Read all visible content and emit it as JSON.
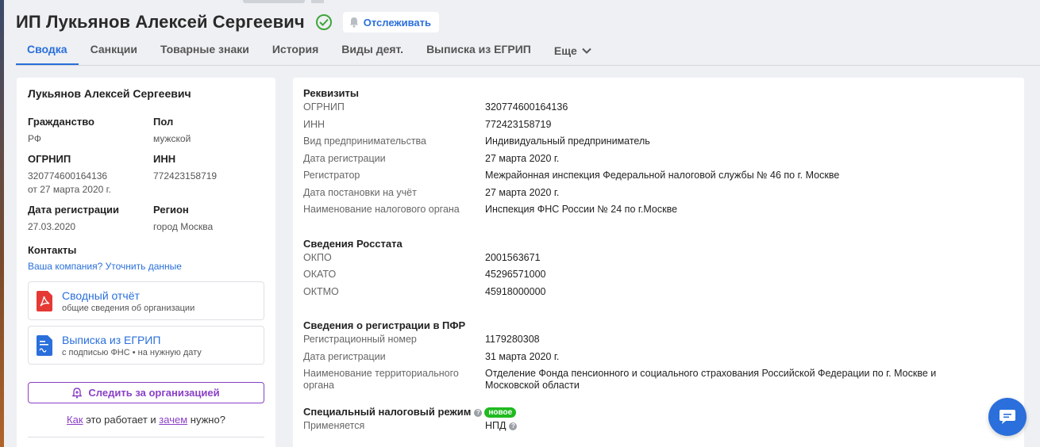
{
  "header": {
    "title": "ИП Лукьянов Алексей Сергеевич",
    "track_label": "Отслеживать"
  },
  "tabs": [
    {
      "label": "Сводка"
    },
    {
      "label": "Санкции"
    },
    {
      "label": "Товарные знаки"
    },
    {
      "label": "История"
    },
    {
      "label": "Виды деят."
    },
    {
      "label": "Выписка из ЕГРИП"
    },
    {
      "label": "Еще"
    }
  ],
  "left": {
    "name": "Лукьянов Алексей Сергеевич",
    "citizenship_label": "Гражданство",
    "citizenship_value": "РФ",
    "gender_label": "Пол",
    "gender_value": "мужской",
    "ogrnip_label": "ОГРНИП",
    "ogrnip_value": "320774600164136",
    "ogrnip_date": "от 27 марта 2020 г.",
    "inn_label": "ИНН",
    "inn_value": "772423158719",
    "regdate_label": "Дата регистрации",
    "regdate_value": "27.03.2020",
    "region_label": "Регион",
    "region_value": "город Москва",
    "contacts_label": "Контакты",
    "contacts_link": "Ваша компания? Уточнить данные",
    "doc1_title": "Сводный отчёт",
    "doc1_sub": "общие сведения об организации",
    "doc2_title": "Выписка из ЕГРИП",
    "doc2_sub": "с подписью ФНС • на нужную дату",
    "follow_label": "Следить за организацией",
    "how_link1": "Как",
    "how_mid": " это работает и ",
    "how_link2": "зачем",
    "how_end": " нужно?"
  },
  "requisites": {
    "title": "Реквизиты",
    "rows": [
      {
        "k": "ОГРНИП",
        "v": "320774600164136"
      },
      {
        "k": "ИНН",
        "v": "772423158719"
      },
      {
        "k": "Вид предпринимательства",
        "v": "Индивидуальный предприниматель"
      },
      {
        "k": "Дата регистрации",
        "v": "27 марта 2020 г."
      },
      {
        "k": "Регистратор",
        "v": "Межрайонная инспекция Федеральной налоговой службы № 46 по г. Москве"
      },
      {
        "k": "Дата постановки на учёт",
        "v": "27 марта 2020 г."
      },
      {
        "k": "Наименование налогового органа",
        "v": "Инспекция ФНС России № 24 по г.Москве"
      }
    ]
  },
  "rosstat": {
    "title": "Сведения Росстата",
    "rows": [
      {
        "k": "ОКПО",
        "v": "2001563671"
      },
      {
        "k": "ОКАТО",
        "v": "45296571000"
      },
      {
        "k": "ОКТМО",
        "v": "45918000000"
      }
    ]
  },
  "pfr": {
    "title": "Сведения о регистрации в ПФР",
    "rows": [
      {
        "k": "Регистрационный номер",
        "v": "1179280308"
      },
      {
        "k": "Дата регистрации",
        "v": "31 марта 2020 г."
      },
      {
        "k": "Наименование территориального органа",
        "v": "Отделение Фонда пенсионного и социального страхования Российской Федерации по г. Москве и Московской области"
      }
    ]
  },
  "tax": {
    "title": "Специальный налоговый режим",
    "badge": "новое",
    "k": "Применяется",
    "v": "НПД"
  },
  "colors": {
    "accent": "#2a6fdb",
    "follow": "#8a3fc7",
    "badge": "#1fba1f",
    "verified": "#3fa53a",
    "pdf": "#e53935"
  }
}
